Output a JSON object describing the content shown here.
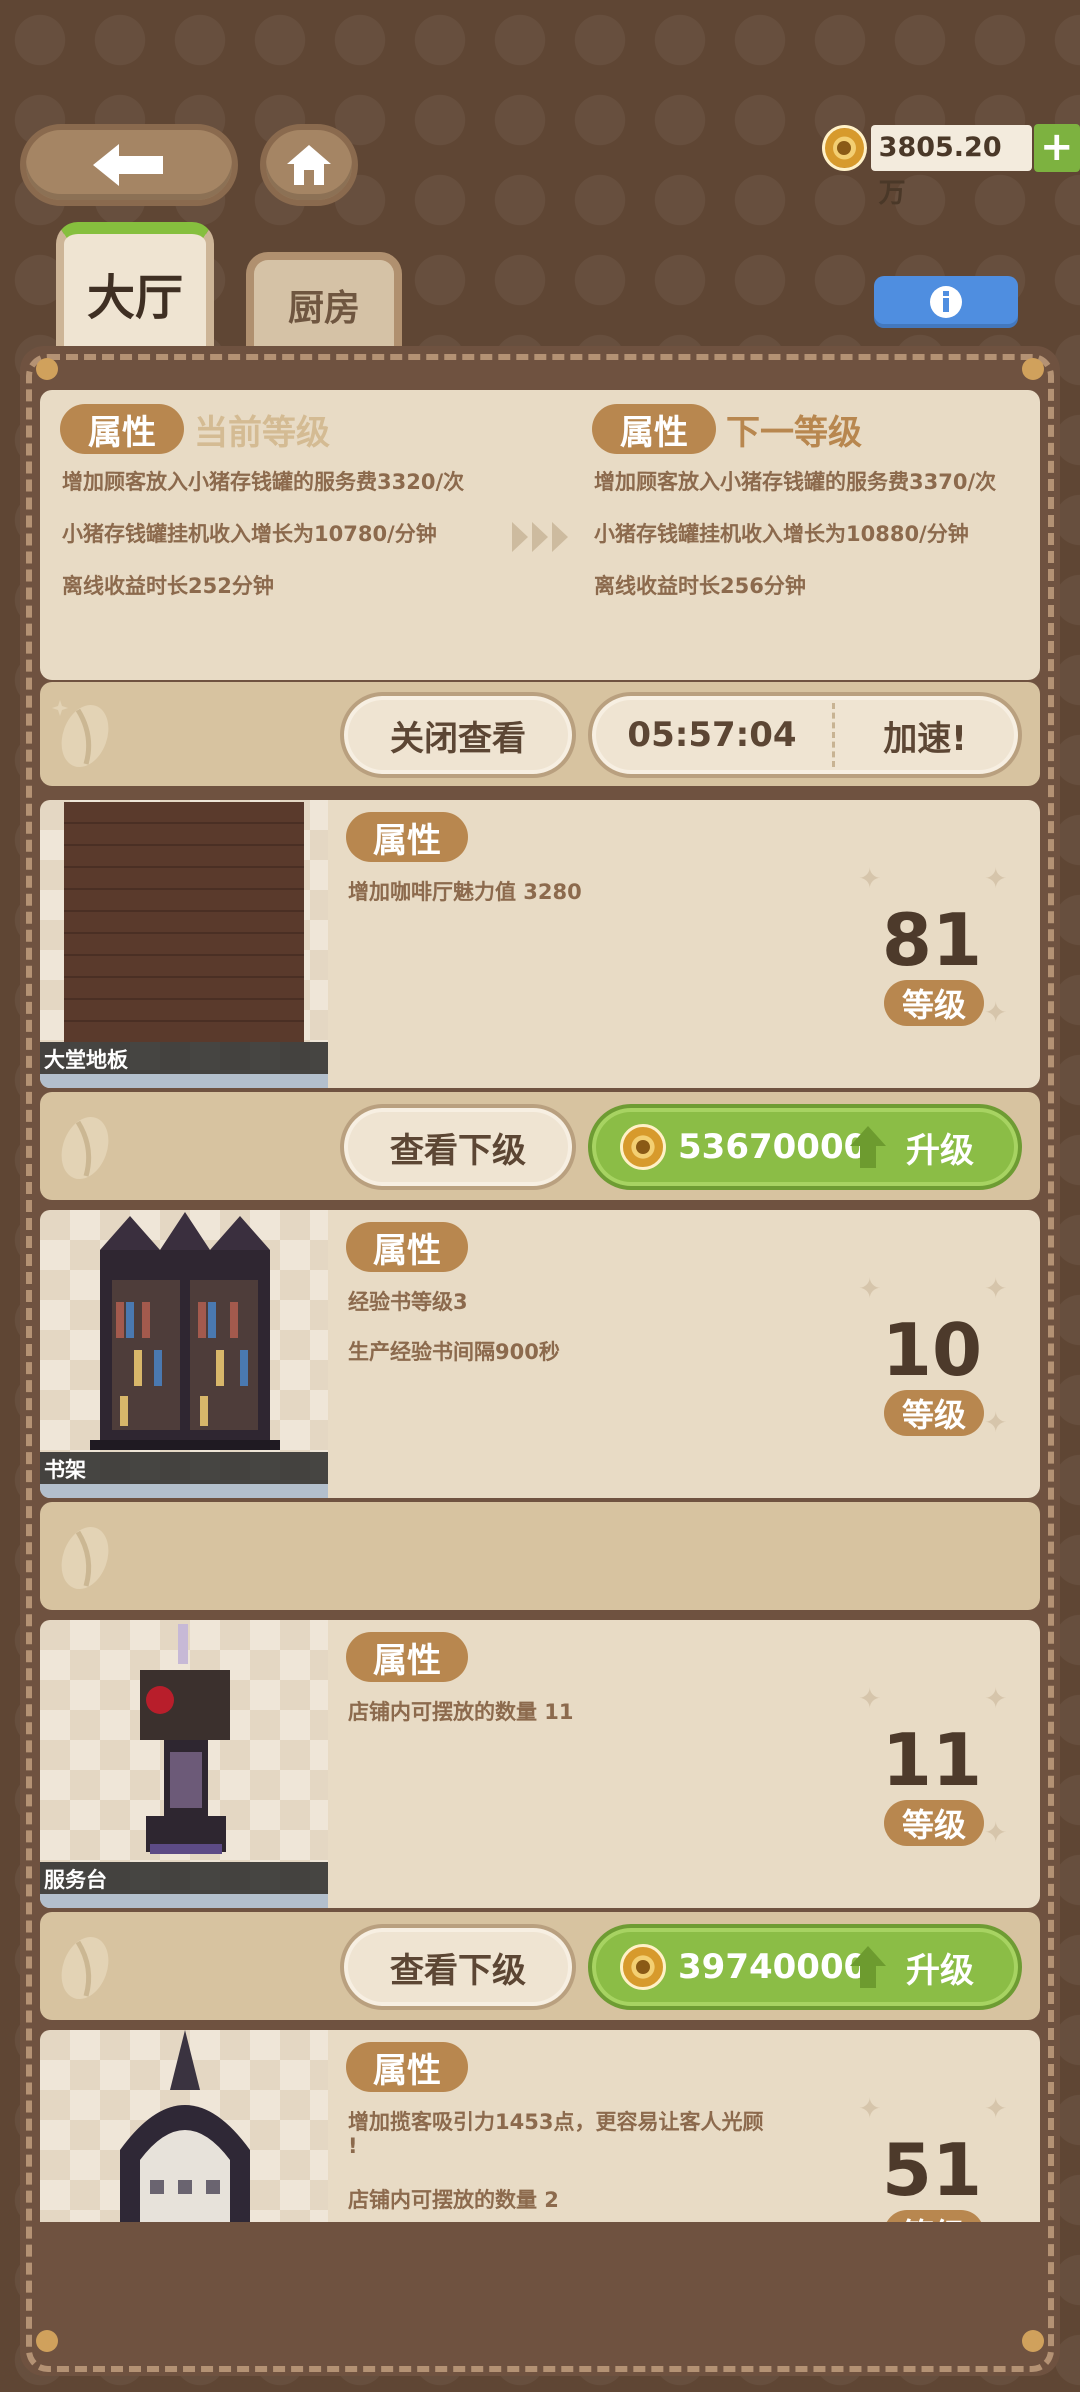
{
  "top": {
    "coins": "3805.20万",
    "add_label": "+"
  },
  "tabs": [
    {
      "label": "大厅",
      "active": true
    },
    {
      "label": "厨房",
      "active": false
    }
  ],
  "info_icon": "info-icon",
  "upgrade_panel": {
    "current": {
      "tag": "属性",
      "title": "当前等级",
      "lines": [
        "增加顾客放入小猪存钱罐的服务费3320/次",
        "小猪存钱罐挂机收入增长为10780/分钟",
        "离线收益时长252分钟"
      ]
    },
    "next": {
      "tag": "属性",
      "title": "下一等级",
      "lines": [
        "增加顾客放入小猪存钱罐的服务费3370/次",
        "小猪存钱罐挂机收入增长为10880/分钟",
        "离线收益时长256分钟"
      ]
    },
    "close_label": "关闭查看",
    "timer": "05:57:04",
    "speed_label": "加速!"
  },
  "items": [
    {
      "name": "大堂地板",
      "tag": "属性",
      "lines": [
        "增加咖啡厅魅力值 3280"
      ],
      "level": "81",
      "level_label": "等级",
      "view_label": "查看下级",
      "price": "53670000",
      "upgrade_label": "升级"
    },
    {
      "name": "书架",
      "tag": "属性",
      "lines": [
        "经验书等级3",
        "生产经验书间隔900秒"
      ],
      "level": "10",
      "level_label": "等级"
    },
    {
      "name": "服务台",
      "tag": "属性",
      "lines": [
        "店铺内可摆放的数量 11"
      ],
      "level": "11",
      "level_label": "等级",
      "view_label": "查看下级",
      "price": "39740000",
      "upgrade_label": "升级"
    },
    {
      "name": "",
      "tag": "属性",
      "lines": [
        "增加揽客吸引力1453点，更容易让客人光顾",
        "!",
        "店铺内可摆放的数量 2"
      ],
      "level": "51",
      "level_label": "等级"
    }
  ],
  "colors": {
    "background": "#5f4634",
    "card": "#e8dbc5",
    "accent_tag": "#b8874f",
    "green_button": "#8bbd46",
    "info_button": "#4f8ee0"
  }
}
